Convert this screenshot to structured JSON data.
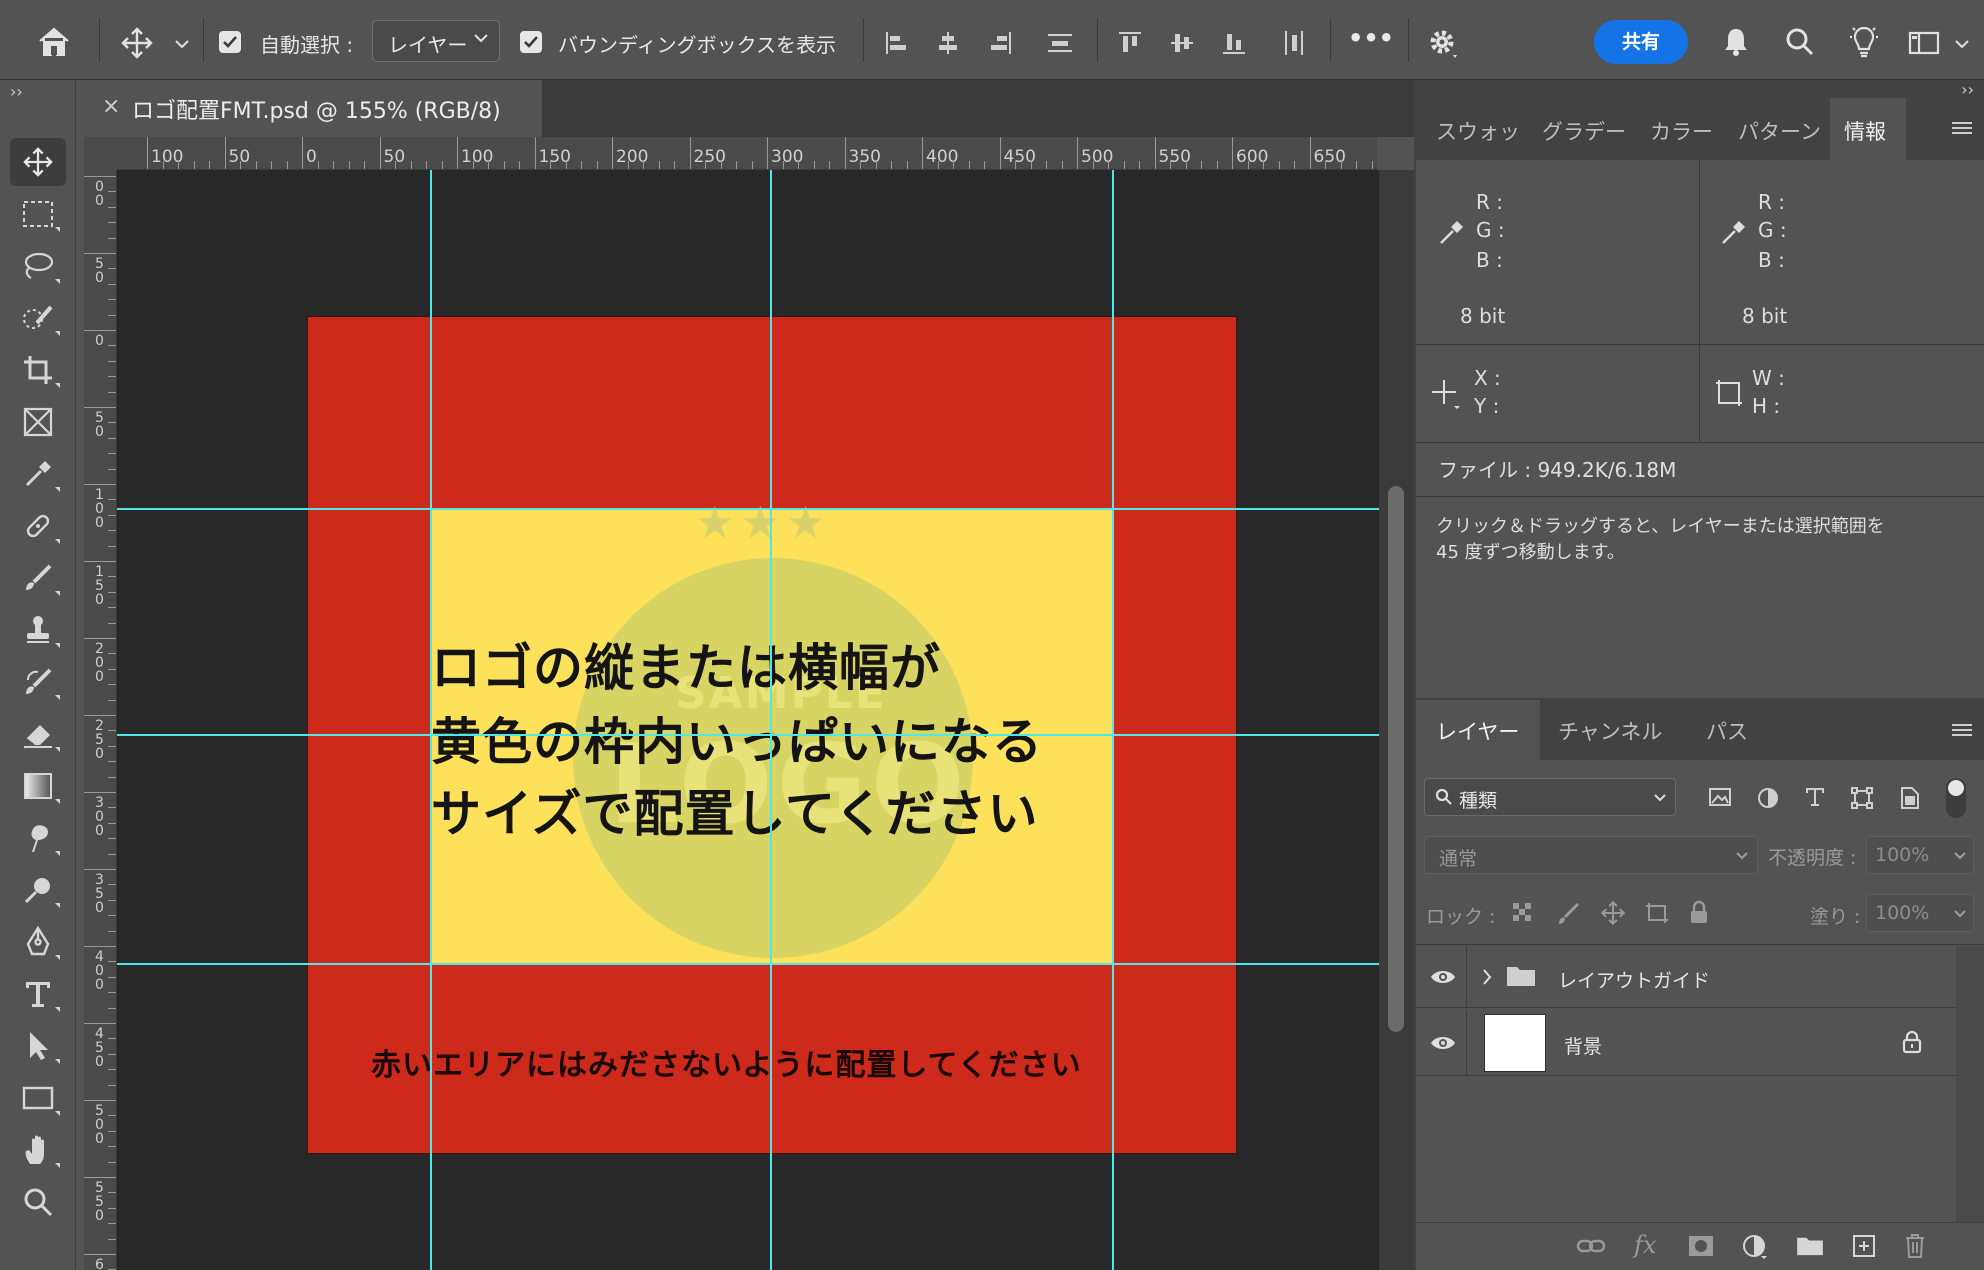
{
  "options_bar": {
    "auto_select_label": "自動選択 :",
    "auto_select_value": "レイヤー",
    "bounding_box_label": "バウンディングボックスを表示",
    "more_label": "•••",
    "share_label": "共有"
  },
  "document": {
    "tab_close": "×",
    "tab_title": "ロゴ配置FMT.psd @ 155% (RGB/8)"
  },
  "rulers": {
    "horizontal": [
      "100",
      "50",
      "0",
      "50",
      "100",
      "150",
      "200",
      "250",
      "300",
      "350",
      "400",
      "450",
      "500",
      "550",
      "600",
      "650"
    ],
    "vertical": [
      "00",
      "50",
      "0",
      "50",
      "100",
      "150",
      "200",
      "250",
      "300",
      "350",
      "400",
      "450",
      "500",
      "550",
      "6"
    ]
  },
  "canvas": {
    "yellow_text_lines": [
      "ロゴの縦または横幅が",
      "黄色の枠内いっぱいになる",
      "サイズで配置してください"
    ],
    "red_area_note": "赤いエリアにはみださないように配置してください",
    "logo_sample_text": "SAMPLE",
    "logo_text": "LOGO",
    "logo_stars": "★★★",
    "colors": {
      "red_area": "#cd2a1c",
      "yellow_area": "#fde15a",
      "guide": "#4ee8ea",
      "pasteboard": "#282828"
    }
  },
  "info_panel": {
    "collapse": "››",
    "tabs": [
      "スウォッ",
      "グラデー",
      "カラー",
      "パターン",
      "情報"
    ],
    "active_tab": "情報",
    "rgb_labels": [
      "R :",
      "G :",
      "B :"
    ],
    "bit_depth_left": "8 bit",
    "bit_depth_right": "8 bit",
    "xy_labels": [
      "X :",
      "Y :"
    ],
    "wh_labels": [
      "W :",
      "H :"
    ],
    "file_info": "ファイル : 949.2K/6.18M",
    "hint_line1": "クリック＆ドラッグすると、レイヤーまたは選択範囲を",
    "hint_line2": "45 度ずつ移動します。"
  },
  "layers_panel": {
    "tabs": [
      "レイヤー",
      "チャンネル",
      "パス"
    ],
    "active_tab": "レイヤー",
    "filter_label": "種類",
    "blend_mode": "通常",
    "opacity_label": "不透明度 :",
    "opacity_value": "100%",
    "lock_label": "ロック :",
    "fill_label": "塗り :",
    "fill_value": "100%",
    "layers": [
      {
        "name": "レイアウトガイド",
        "type": "group",
        "visible": true
      },
      {
        "name": "背景",
        "type": "background",
        "visible": true,
        "locked": true
      }
    ]
  },
  "toolbar": {
    "collapse": "››"
  }
}
